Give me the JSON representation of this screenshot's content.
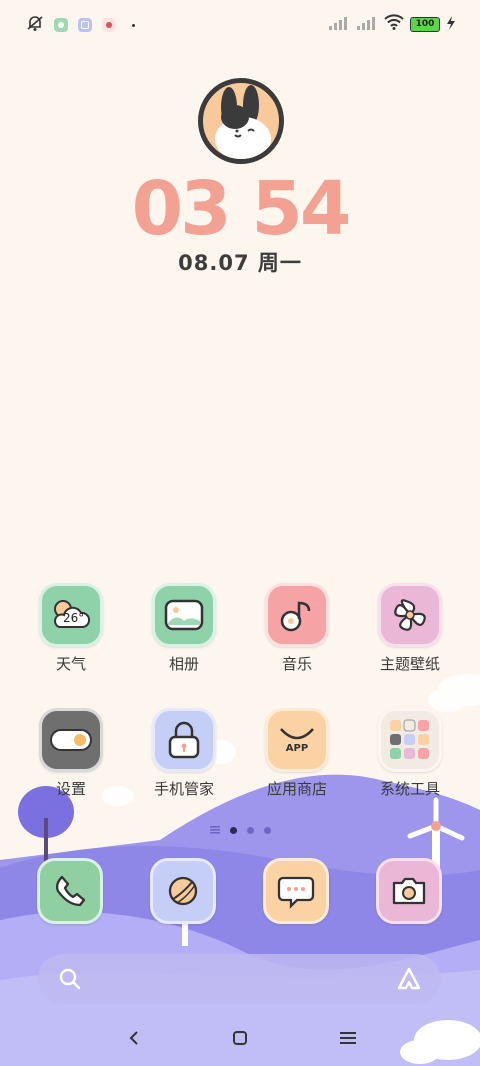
{
  "status": {
    "battery": "100",
    "icons": [
      "mute-bell-icon",
      "app-notification-icon",
      "app-notification-icon",
      "app-notification-icon",
      "signal-icon",
      "signal-icon",
      "wifi-icon",
      "battery-icon",
      "charging-icon"
    ]
  },
  "clock": {
    "time": "03 54",
    "date": "08.07  周一"
  },
  "apps": [
    {
      "name": "weather",
      "label": "天气",
      "temp": "26°",
      "bg": "#8fd1a8"
    },
    {
      "name": "gallery",
      "label": "相册",
      "bg": "#8fd1a8"
    },
    {
      "name": "music",
      "label": "音乐",
      "bg": "#f6a3a6"
    },
    {
      "name": "themes",
      "label": "主题壁纸",
      "bg": "#eab7d7"
    },
    {
      "name": "settings",
      "label": "设置",
      "bg": "#6f6f6f"
    },
    {
      "name": "security",
      "label": "手机管家",
      "bg": "#c5cef6"
    },
    {
      "name": "app-store",
      "label": "应用商店",
      "bg": "#fbd2a3",
      "text": "APP"
    },
    {
      "name": "system-tools",
      "label": "系统工具",
      "bg": "#f2ebe3"
    }
  ],
  "dock": [
    {
      "name": "phone",
      "bg": "#8fcfa2"
    },
    {
      "name": "browser",
      "bg": "#c5cef6"
    },
    {
      "name": "messages",
      "bg": "#fbd2a3"
    },
    {
      "name": "camera",
      "bg": "#eab7d7"
    }
  ],
  "pager": {
    "pages": 3,
    "current": 1
  },
  "colors": {
    "accent": "#f2a193",
    "hills": "#8c84e6",
    "background": "#fdf6ef"
  }
}
